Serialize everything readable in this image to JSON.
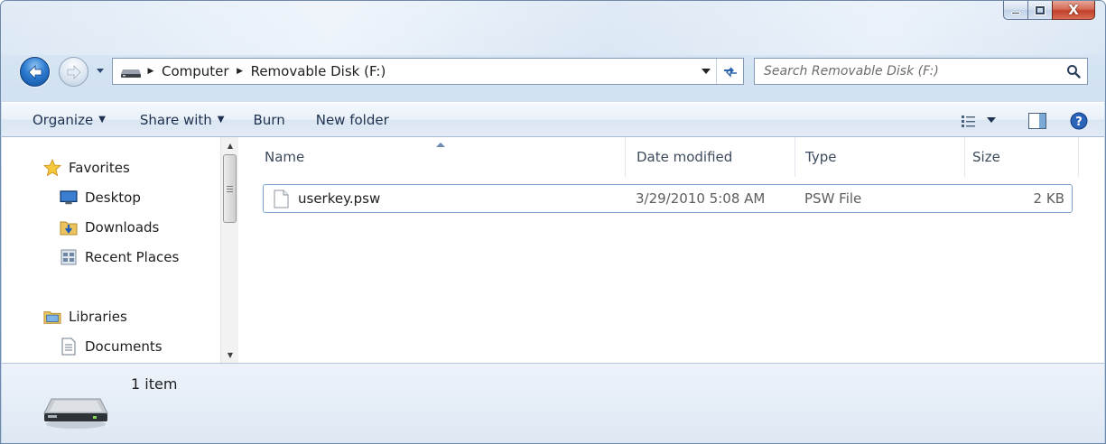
{
  "window": {
    "caption_buttons": {
      "minimize": "minimize-icon",
      "maximize": "maximize-icon",
      "close_label": "X"
    }
  },
  "navigation": {
    "back": "back-arrow-icon",
    "forward": "forward-arrow-icon",
    "history": "chevron-down-icon"
  },
  "address": {
    "breadcrumbs": [
      "Computer",
      "Removable Disk (F:)"
    ],
    "refresh": "refresh-icon"
  },
  "search": {
    "placeholder": "Search Removable Disk (F:)",
    "icon": "search-icon"
  },
  "commandbar": {
    "organize": "Organize",
    "share_with": "Share with",
    "burn": "Burn",
    "new_folder": "New folder",
    "view_icon": "change-view-icon",
    "preview_icon": "preview-pane-icon",
    "help_icon": "help-icon"
  },
  "navpane": {
    "favorites": {
      "label": "Favorites",
      "items": [
        {
          "label": "Desktop",
          "icon": "desktop-icon"
        },
        {
          "label": "Downloads",
          "icon": "downloads-folder-icon"
        },
        {
          "label": "Recent Places",
          "icon": "recent-places-icon"
        }
      ]
    },
    "libraries": {
      "label": "Libraries",
      "items": [
        {
          "label": "Documents",
          "icon": "documents-icon"
        }
      ]
    }
  },
  "filelist": {
    "columns": [
      "Name",
      "Date modified",
      "Type",
      "Size"
    ],
    "sort_column": "Name",
    "rows": [
      {
        "name": "userkey.psw",
        "date_modified": "3/29/2010 5:08 AM",
        "type": "PSW File",
        "size": "2 KB"
      }
    ]
  },
  "details": {
    "summary": "1 item",
    "icon": "removable-disk-icon"
  }
}
